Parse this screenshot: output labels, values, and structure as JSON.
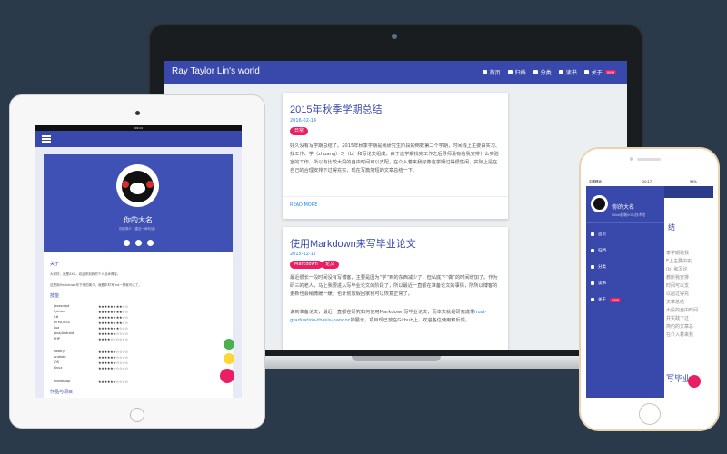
{
  "laptop": {
    "site_title": "Ray Taylor Lin's world",
    "nav": [
      {
        "icon": "home-icon",
        "label": "首页"
      },
      {
        "icon": "archive-icon",
        "label": "归档"
      },
      {
        "icon": "category-icon",
        "label": "分类"
      },
      {
        "icon": "book-icon",
        "label": "读书"
      },
      {
        "icon": "user-icon",
        "label": "关于"
      }
    ],
    "new_badge": "new",
    "posts": [
      {
        "title": "2015年秋季学期总结",
        "date": "2016-02-14",
        "tags": [
          "日常"
        ],
        "excerpt": "好久没有写学期总结了。2015年秋季学期是我研究生阶段的倒数第二个学期，时间线上主要由实习、找工作、学（zhuang）习（b）和写论文组成。由于这学期找完工作之后导师没有给我安排什么实验室的工作，所以有比较大段的自由时间可以支配。在介入着来我好像这学期过得很悠闲，实际上是在自己的合理安排下过得充实，现在写篇简短的文章总结一下。",
        "more": "READ MORE"
      },
      {
        "title": "使用Markdown来写毕业论文",
        "date": "2015-12-17",
        "tags": [
          "Markdown",
          "论文"
        ],
        "excerpt1": "最近很长一段时间没有写博客，主要是因为“学”到的东西减少了，但私底下“做”的时间增加了。作为研三的老人，马上我要进入写毕业论文的阶段了，所以最近一直都在准备论文的事情，所所以博客的更新也会稍微缓一缓，也计划放假回家我可以恢复正常了。",
        "excerpt2_a": "说到准备论文，最近一直都在研究如何使用Markdown写毕业论文，而本文就是研究成果",
        "excerpt2_link": "hust-graduation-thesis-pandoc",
        "excerpt2_b": "的展示。项目现已放在Github上，欢迎各位使用和反馈。"
      }
    ]
  },
  "tablet": {
    "status_time": "09:14",
    "name": "你的大名",
    "subtitle": "你的简介（建议一两句话）",
    "about_title": "关于",
    "about_text1": "大家好，我是XXX。欢迎来到我的个人技术博客。",
    "about_text2": "这是用Markdown写下你的简介，就跟平时写md一样就可以了。",
    "skills_title": "技能",
    "skills": [
      {
        "name": "Javascript",
        "rating": "★★★★★★★★☆☆"
      },
      {
        "name": "Python",
        "rating": "★★★★★★★★☆☆"
      },
      {
        "name": "C#",
        "rating": "★★★★★★★★☆☆"
      },
      {
        "name": "HTML/CSS",
        "rating": "★★★★★★★★☆☆"
      },
      {
        "name": "Lua",
        "rating": "★★★★★★★☆☆☆"
      },
      {
        "name": "Java/Android",
        "rating": "★★★★★★☆☆☆☆"
      },
      {
        "name": "PHP",
        "rating": "★★★★☆☆☆☆☆☆"
      },
      {
        "name": "Node.js",
        "rating": "★★★★★★☆☆☆☆"
      },
      {
        "name": "Android",
        "rating": "★★★★★★☆☆☆☆"
      },
      {
        "name": "iOS",
        "rating": "★★★★★★☆☆☆☆"
      },
      {
        "name": "Linux",
        "rating": "★★★★★☆☆☆☆☆"
      },
      {
        "name": "Photoshop",
        "rating": "★★★★★★☆☆☆☆"
      }
    ],
    "works_title": "作品与项目"
  },
  "phone": {
    "carrier": "中国移动",
    "time": "20:17",
    "battery": "96%",
    "name": "你的大名",
    "desc": "Web前端/iOS/技术宅",
    "menu": [
      {
        "icon": "home-icon",
        "label": "首页"
      },
      {
        "icon": "archive-icon",
        "label": "归档"
      },
      {
        "icon": "category-icon",
        "label": "分类"
      },
      {
        "icon": "book-icon",
        "label": "读书"
      },
      {
        "icon": "user-icon",
        "label": "关于"
      }
    ],
    "new_badge": "new",
    "bg_heading": "结",
    "bg_heading2": "写毕业",
    "bg_lines": [
      "季学期是我",
      "E上主要由实",
      "(b) 和写论",
      "教所我安排",
      "时间可以支",
      "以超过得充",
      "文章总结一",
      "大段的自由时间",
      "并实践下过",
      "简约的文章总",
      "在介入着来我"
    ]
  },
  "colors": {
    "primary": "#3949ab",
    "accent": "#e91e63",
    "background": "#2b3a4a"
  }
}
